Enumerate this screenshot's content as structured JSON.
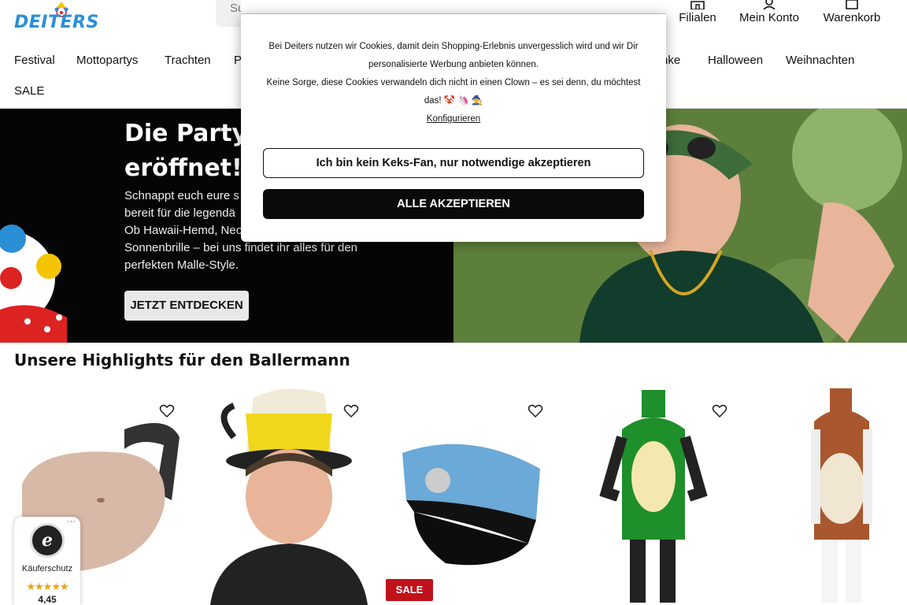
{
  "header": {
    "logo_text": "DEITERS",
    "search_placeholder": "Su",
    "filialen": "Filialen",
    "mein_konto": "Mein Konto",
    "warenkorb": "Warenkorb"
  },
  "nav": {
    "items": [
      "Festival",
      "Mottopartys",
      "Trachten",
      "P",
      "nke",
      "Halloween",
      "Weihnachten"
    ],
    "sale": "SALE"
  },
  "hero": {
    "title_line1": "Die Partys",
    "title_line2": "eröffnet!",
    "text_lines": [
      "Schnappt euch eure s",
      "bereit für die legendä",
      "Ob Hawaii-Hemd, Neo",
      "Sonnenbrille – bei uns findet ihr alles für den",
      "perfekten Malle-Style."
    ],
    "button": "JETZT ENTDECKEN"
  },
  "highlights": {
    "title": "Unsere Highlights für den Ballermann",
    "sale_badge": "SALE"
  },
  "trust": {
    "label": "Käuferschutz",
    "stars": "★★★★★",
    "score": "4,45",
    "more": "···"
  },
  "cookie": {
    "line1": "Bei Deiters nutzen wir Cookies, damit dein Shopping-Erlebnis unvergesslich wird und wir Dir personalisierte Werbung anbieten können.",
    "line2": "Keine Sorge, diese Cookies verwandeln dich nicht in einen Clown – es sei denn, du möchtest das! 🤡 🦄 🧙",
    "configure": "Konfigurieren",
    "btn_necessary": "Ich bin kein Keks-Fan, nur notwendige akzeptieren",
    "btn_all": "ALLE AKZEPTIEREN"
  },
  "colors": {
    "brand_blue": "#2b8fd6",
    "hero_bg": "#050505",
    "sale_red": "#c0121b",
    "button_dark": "#0a0a0a"
  }
}
